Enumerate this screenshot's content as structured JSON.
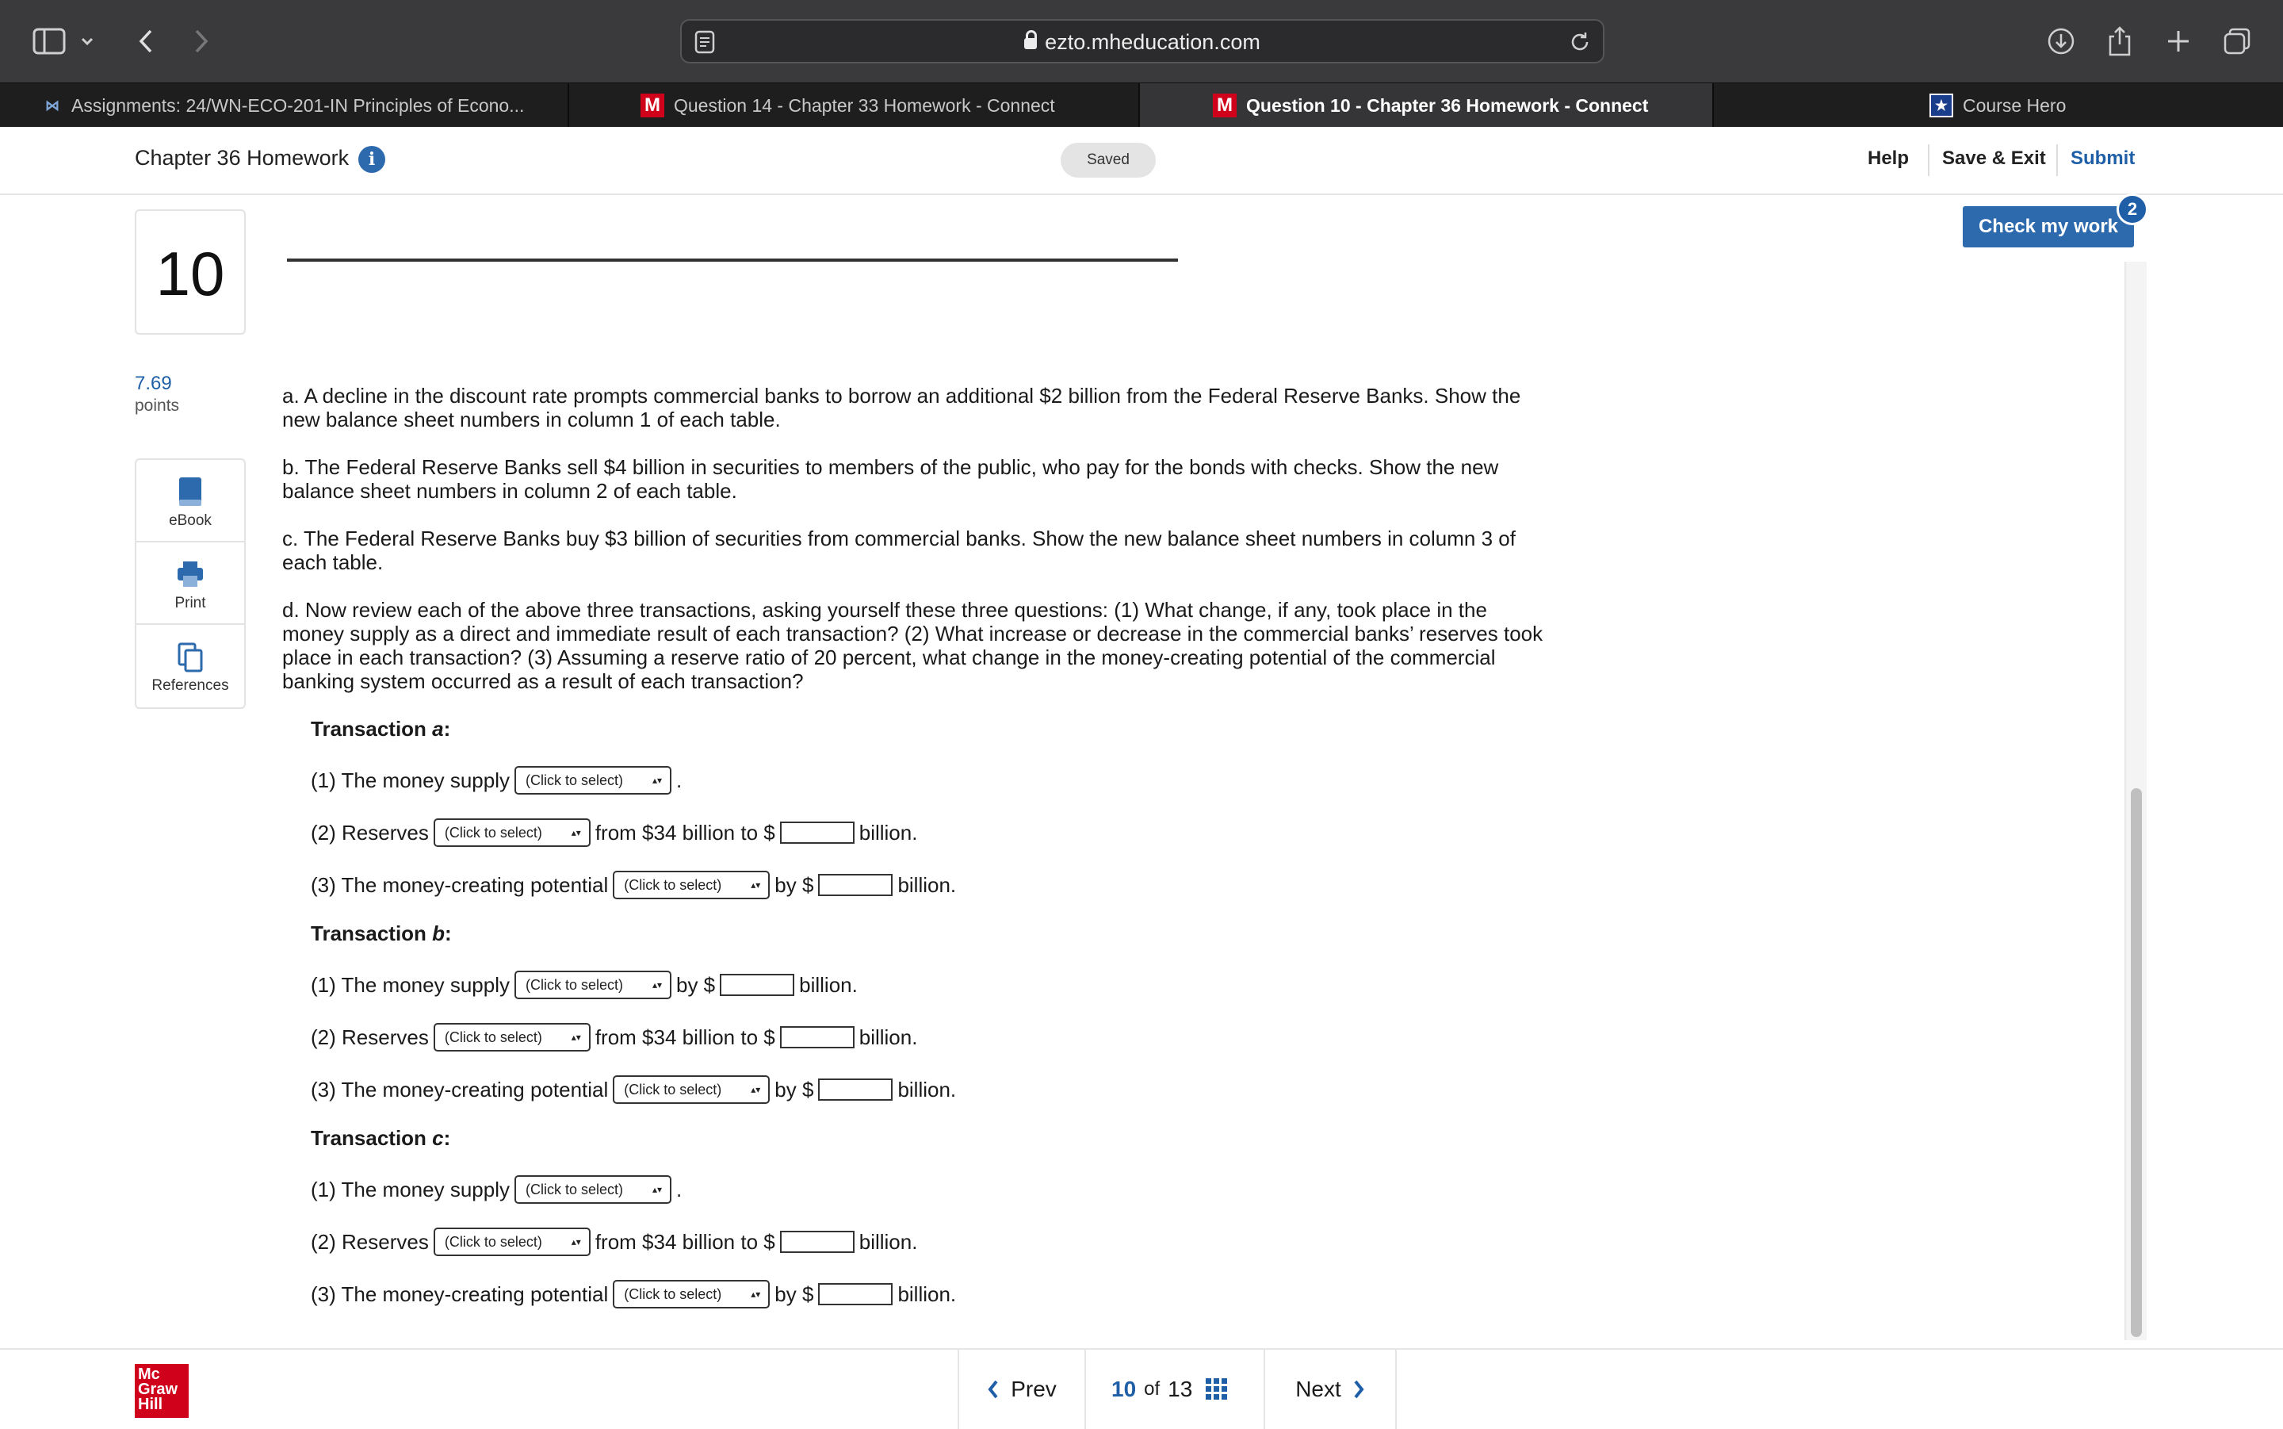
{
  "browser": {
    "url": "ezto.mheducation.com",
    "tabs": [
      {
        "label": "Assignments: 24/WN-ECO-201-IN Principles of Econo...",
        "icon": "mcgraw-favicon-icon"
      },
      {
        "label": "Question 14 - Chapter 33 Homework - Connect",
        "icon": "m-logo-icon"
      },
      {
        "label": "Question 10 - Chapter 36 Homework - Connect",
        "icon": "m-logo-icon"
      },
      {
        "label": "Course Hero",
        "icon": "course-hero-icon"
      }
    ],
    "tab_letter": "M"
  },
  "header": {
    "title": "Chapter 36 Homework",
    "saved": "Saved",
    "help": "Help",
    "save_exit": "Save & Exit",
    "submit": "Submit"
  },
  "question": {
    "number": "10",
    "points_value": "7.69",
    "points_label": "points",
    "check_label": "Check my work",
    "check_badge": "2",
    "tools": [
      "eBook",
      "Print",
      "References"
    ],
    "paragraphs": [
      "a. A decline in the discount rate prompts commercial banks to borrow an additional $2 billion from the Federal Reserve Banks. Show the new balance sheet numbers in column 1 of each table.",
      "b. The Federal Reserve Banks sell $4 billion in securities to members of the public, who pay for the bonds with checks. Show the new balance sheet numbers in column 2 of each table.",
      "c. The Federal Reserve Banks buy $3 billion of securities from commercial banks. Show the new balance sheet numbers in column 3 of each table.",
      "d. Now review each of the above three transactions, asking yourself these three questions: (1) What change, if any, took place in the money supply as a direct and immediate result of each transaction? (2) What increase or decrease in the commercial banks’ reserves took place in each transaction? (3) Assuming a reserve ratio of 20 percent, what change in the money-creating potential of the commercial banking system occurred as a result of each transaction?"
    ],
    "transactions": [
      {
        "prefix": "Transaction ",
        "letter": "a",
        "suffix": ":",
        "rows": [
          {
            "pre": "(1) The money supply",
            "select": "(Click to select)",
            "post": "."
          },
          {
            "pre": "(2) Reserves",
            "select": "(Click to select)",
            "mid": "from $34 billion to $",
            "post": "billion."
          },
          {
            "pre": "(3) The money-creating potential",
            "select": "(Click to select)",
            "mid": "by $",
            "post": "billion."
          }
        ]
      },
      {
        "prefix": "Transaction ",
        "letter": "b",
        "suffix": ":",
        "rows": [
          {
            "pre": "(1) The money supply",
            "select": "(Click to select)",
            "mid": "by $",
            "post": "billion."
          },
          {
            "pre": "(2) Reserves",
            "select": "(Click to select)",
            "mid": "from $34 billion to $",
            "post": "billion."
          },
          {
            "pre": "(3) The money-creating potential",
            "select": "(Click to select)",
            "mid": "by $",
            "post": "billion."
          }
        ]
      },
      {
        "prefix": "Transaction ",
        "letter": "c",
        "suffix": ":",
        "rows": [
          {
            "pre": "(1) The money supply",
            "select": "(Click to select)",
            "post": "."
          },
          {
            "pre": "(2) Reserves",
            "select": "(Click to select)",
            "mid": "from $34 billion to $",
            "post": "billion."
          },
          {
            "pre": "(3) The money-creating potential",
            "select": "(Click to select)",
            "mid": "by $",
            "post": "billion."
          }
        ]
      }
    ]
  },
  "footer": {
    "logo": [
      "Mc",
      "Graw",
      "Hill"
    ],
    "prev": "Prev",
    "current": "10",
    "of": "of",
    "total": "13",
    "next": "Next"
  }
}
